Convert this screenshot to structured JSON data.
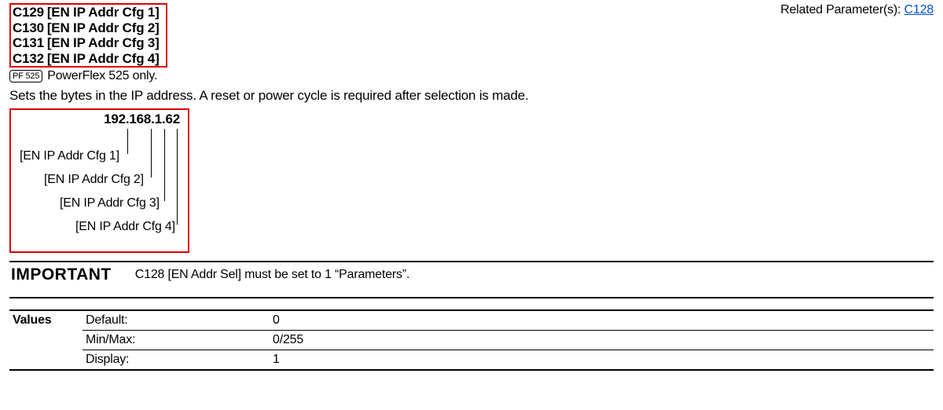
{
  "params": [
    {
      "id": "C129",
      "name": "[EN IP Addr Cfg 1]"
    },
    {
      "id": "C130",
      "name": "[EN IP Addr Cfg 2]"
    },
    {
      "id": "C131",
      "name": "[EN IP Addr Cfg 3]"
    },
    {
      "id": "C132",
      "name": "[EN IP Addr Cfg 4]"
    }
  ],
  "related": {
    "prefix": "Related Parameter(s): ",
    "link": "C128"
  },
  "pf": {
    "badge": "PF 525",
    "text": "PowerFlex 525 only."
  },
  "desc": "Sets the bytes in the IP address. A reset or power cycle is required after selection is made.",
  "ip": {
    "address": "192.168.1.62",
    "labels": [
      "[EN IP Addr Cfg 1]",
      "[EN IP Addr Cfg 2]",
      "[EN IP Addr Cfg 3]",
      "[EN IP Addr Cfg 4]"
    ]
  },
  "important": {
    "label": "IMPORTANT",
    "text": "C128 [EN Addr Sel] must be set to 1 “Parameters”."
  },
  "values": {
    "heading": "Values",
    "rows": [
      {
        "label": "Default:",
        "value": "0"
      },
      {
        "label": "Min/Max:",
        "value": "0/255"
      },
      {
        "label": "Display:",
        "value": "1"
      }
    ]
  }
}
